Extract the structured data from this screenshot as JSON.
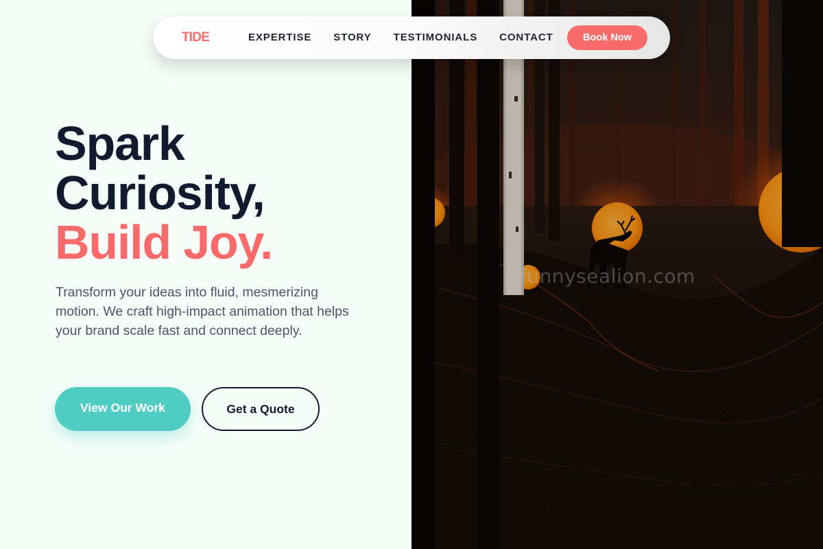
{
  "nav": {
    "logo": "TIDE",
    "links": [
      "EXPERTISE",
      "STORY",
      "TESTIMONIALS",
      "CONTACT"
    ],
    "cta": "Book Now"
  },
  "hero": {
    "title_line1": "Spark",
    "title_line2": "Curiosity,",
    "title_line3": "Build Joy.",
    "description": "Transform your ideas into fluid, mesmerizing motion. We craft high-impact animation that helps your brand scale fast and connect deeply.",
    "primary_button": "View Our Work",
    "secondary_button": "Get a Quote"
  },
  "image": {
    "subject": "forest-night-deer-glowing-orbs",
    "watermark": "funnysealion.com"
  },
  "colors": {
    "accent": "#f86b6b",
    "teal": "#4fcdc2",
    "navy": "#111a2e",
    "background": "#f6fdf9"
  }
}
